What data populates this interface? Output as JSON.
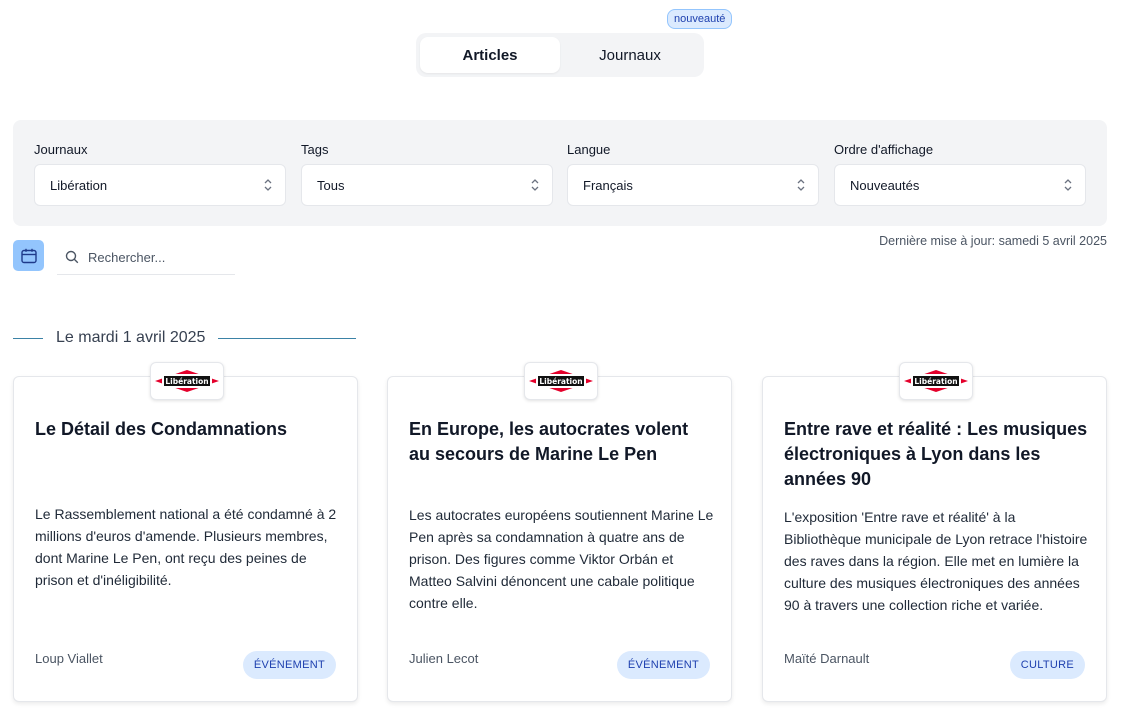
{
  "tabs": {
    "badge": "nouveauté",
    "items": [
      {
        "label": "Articles",
        "active": true
      },
      {
        "label": "Journaux",
        "active": false
      }
    ]
  },
  "filters": [
    {
      "label": "Journaux",
      "value": "Libération"
    },
    {
      "label": "Tags",
      "value": "Tous"
    },
    {
      "label": "Langue",
      "value": "Français"
    },
    {
      "label": "Ordre d'affichage",
      "value": "Nouveautés"
    }
  ],
  "search": {
    "placeholder": "Rechercher..."
  },
  "last_update": "Dernière mise à jour: samedi 5 avril 2025",
  "date_group": "Le mardi 1 avril 2025",
  "articles": [
    {
      "logo": "Libération",
      "title": "Le Détail des Condamnations",
      "description": "Le Rassemblement national a été condamné à 2 millions d'euros d'amende. Plusieurs membres, dont Marine Le Pen, ont reçu des peines de prison et d'inéligibilité.",
      "author": "Loup Viallet",
      "tag": "ÉVÉNEMENT"
    },
    {
      "logo": "Libération",
      "title": "En Europe, les autocrates volent au secours de Marine Le Pen",
      "description": "Les autocrates européens soutiennent Marine Le Pen après sa condamnation à quatre ans de prison. Des figures comme Viktor Orbán et Matteo Salvini dénoncent une cabale politique contre elle.",
      "author": "Julien Lecot",
      "tag": "ÉVÉNEMENT"
    },
    {
      "logo": "Libération",
      "title": "Entre rave et réalité : Les musiques électroniques à Lyon dans les années 90",
      "description": "L'exposition 'Entre rave et réalité' à la Bibliothèque municipale de Lyon retrace l'histoire des raves dans la région. Elle met en lumière la culture des musiques électroniques des années 90 à travers une collection riche et variée.",
      "author": "Maïté Darnault",
      "tag": "CULTURE"
    }
  ],
  "colors": {
    "accent": "#93c5fd",
    "tag_bg": "#dbeafe",
    "tag_text": "#1e40af",
    "logo_red": "#e4002b"
  }
}
